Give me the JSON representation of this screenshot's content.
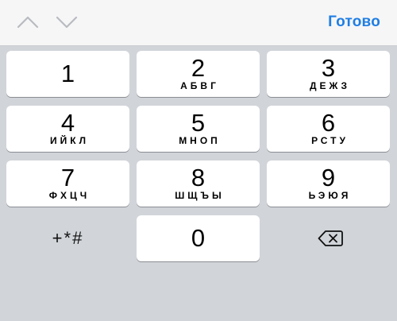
{
  "toolbar": {
    "prev_icon": "chevron-up-icon",
    "next_icon": "chevron-down-icon",
    "done_label": "Готово",
    "accent_color": "#1f7ee3"
  },
  "keys": [
    {
      "digit": "1",
      "letters": ""
    },
    {
      "digit": "2",
      "letters": "АБВГ"
    },
    {
      "digit": "3",
      "letters": "ДЕЖЗ"
    },
    {
      "digit": "4",
      "letters": "ИЙКЛ"
    },
    {
      "digit": "5",
      "letters": "МНОП"
    },
    {
      "digit": "6",
      "letters": "РСТУ"
    },
    {
      "digit": "7",
      "letters": "ФХЦЧ"
    },
    {
      "digit": "8",
      "letters": "ШЩЪЫ"
    },
    {
      "digit": "9",
      "letters": "ЬЭЮЯ"
    },
    {
      "digit": "0",
      "letters": ""
    }
  ],
  "symbols_label": "+*#",
  "backspace_icon": "backspace-icon"
}
